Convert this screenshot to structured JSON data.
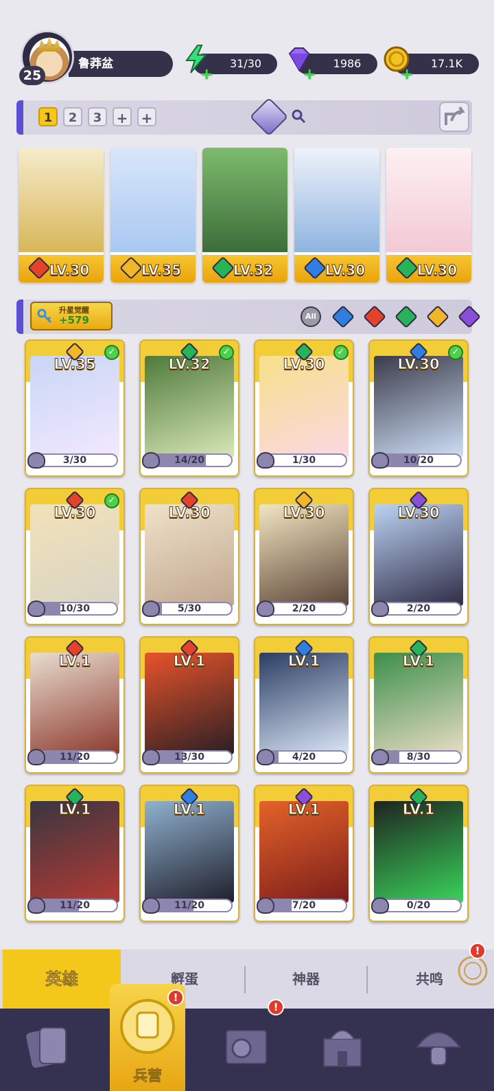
{
  "player": {
    "level": "25",
    "name": "鲁莽盆"
  },
  "resources": {
    "energy": "31/30",
    "gems": "1986",
    "gold": "17.1K"
  },
  "team_slots": [
    "1",
    "2",
    "3",
    "+",
    "+"
  ],
  "team_slot_active": "1",
  "team_gem_count": "3",
  "team": [
    {
      "level": "LV.30",
      "element": "fire"
    },
    {
      "level": "LV.35",
      "element": "light"
    },
    {
      "level": "LV.32",
      "element": "nature"
    },
    {
      "level": "LV.30",
      "element": "water"
    },
    {
      "level": "LV.30",
      "element": "nature"
    }
  ],
  "awaken": {
    "title": "升星觉醒",
    "value": "+579"
  },
  "filters": [
    "All",
    "water",
    "fire",
    "nature",
    "light",
    "dark"
  ],
  "heroes": [
    {
      "level": "LV.35",
      "element": "light",
      "shards": "3/30",
      "fill": 0.1,
      "checked": true,
      "art": [
        "#c9d6f5",
        "#f2e8ff"
      ]
    },
    {
      "level": "LV.32",
      "element": "nature",
      "shards": "14/20",
      "fill": 0.7,
      "checked": true,
      "art": [
        "#4f7a3b",
        "#d9e7b8"
      ]
    },
    {
      "level": "LV.30",
      "element": "nature",
      "shards": "1/30",
      "fill": 0.03,
      "checked": true,
      "art": [
        "#f7e08a",
        "#fbd7e3"
      ]
    },
    {
      "level": "LV.30",
      "element": "water",
      "shards": "10/20",
      "fill": 0.5,
      "checked": true,
      "art": [
        "#3a3b4a",
        "#cfe0f7"
      ]
    },
    {
      "level": "LV.30",
      "element": "fire",
      "shards": "10/30",
      "fill": 0.33,
      "checked": true,
      "art": [
        "#f2e2b8",
        "#d9d4c6"
      ]
    },
    {
      "level": "LV.30",
      "element": "fire",
      "shards": "5/30",
      "fill": 0.17,
      "checked": false,
      "art": [
        "#efe2c8",
        "#c0a690"
      ]
    },
    {
      "level": "LV.30",
      "element": "light",
      "shards": "2/20",
      "fill": 0.1,
      "checked": false,
      "art": [
        "#f3e6c2",
        "#5a4436"
      ]
    },
    {
      "level": "LV.30",
      "element": "dark",
      "shards": "2/20",
      "fill": 0.1,
      "checked": false,
      "art": [
        "#bcd3f3",
        "#2e2b45"
      ]
    },
    {
      "level": "LV.1",
      "element": "fire",
      "shards": "11/20",
      "fill": 0.55,
      "checked": false,
      "art": [
        "#e9ddd0",
        "#8c3a2d"
      ]
    },
    {
      "level": "LV.1",
      "element": "fire",
      "shards": "13/30",
      "fill": 0.43,
      "checked": false,
      "art": [
        "#e8532b",
        "#2a1f24"
      ]
    },
    {
      "level": "LV.1",
      "element": "water",
      "shards": "4/20",
      "fill": 0.2,
      "checked": false,
      "art": [
        "#2a3d63",
        "#dbe6f6"
      ]
    },
    {
      "level": "LV.1",
      "element": "nature",
      "shards": "8/30",
      "fill": 0.27,
      "checked": false,
      "art": [
        "#3b8f4b",
        "#e9dcc4"
      ]
    },
    {
      "level": "LV.1",
      "element": "nature",
      "shards": "11/20",
      "fill": 0.55,
      "checked": false,
      "art": [
        "#3a3640",
        "#b33a34"
      ]
    },
    {
      "level": "LV.1",
      "element": "water",
      "shards": "11/20",
      "fill": 0.55,
      "checked": false,
      "art": [
        "#8fb1cf",
        "#1f1f2a"
      ]
    },
    {
      "level": "LV.1",
      "element": "dark",
      "shards": "7/20",
      "fill": 0.35,
      "checked": false,
      "art": [
        "#e5622a",
        "#7a1e1a"
      ]
    },
    {
      "level": "LV.1",
      "element": "nature",
      "shards": "0/20",
      "fill": 0.0,
      "checked": false,
      "art": [
        "#1e2320",
        "#3ad35a"
      ]
    }
  ],
  "subtabs": [
    "英雄",
    "孵蛋",
    "神器",
    "共鸣"
  ],
  "subtab_active": "英雄",
  "bottom_nav": {
    "active_label": "兵营",
    "items": [
      "cards-icon",
      "barracks-icon",
      "map-icon",
      "castle-icon",
      "mushroom-icon"
    ]
  },
  "element_colors": {
    "fire": "#e4432b",
    "water": "#2f7fe0",
    "nature": "#27b35a",
    "light": "#f2b629",
    "dark": "#8a4fd9"
  }
}
